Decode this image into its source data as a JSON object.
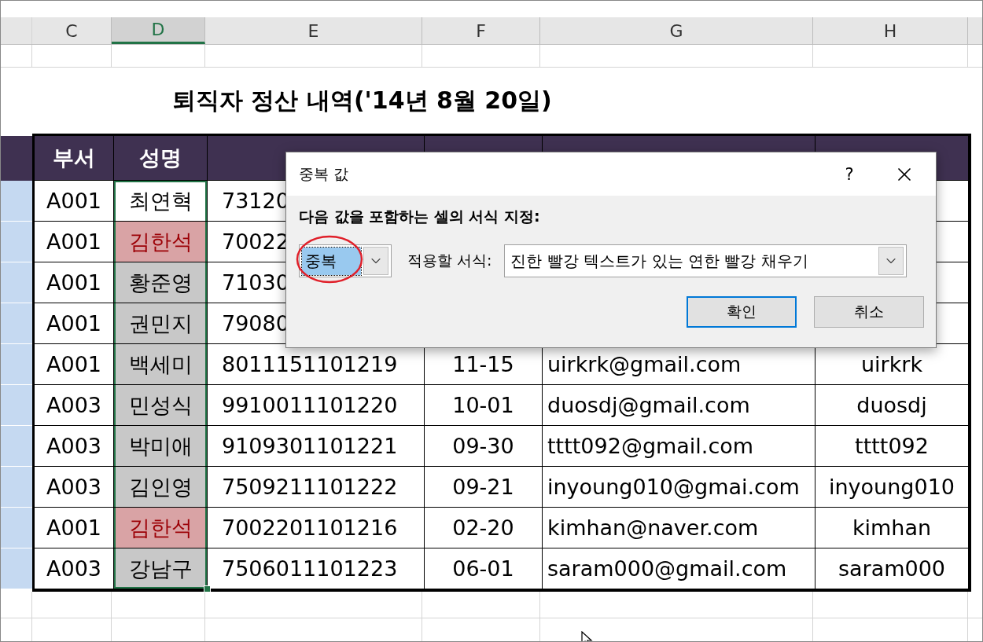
{
  "columns": [
    {
      "letter": "C",
      "selected": false
    },
    {
      "letter": "D",
      "selected": true
    },
    {
      "letter": "E",
      "selected": false
    },
    {
      "letter": "F",
      "selected": false
    },
    {
      "letter": "G",
      "selected": false
    },
    {
      "letter": "H",
      "selected": false
    }
  ],
  "title": "퇴직자 정산 내역('14년 8월 20일)",
  "table": {
    "headers": [
      "부서",
      "성명"
    ],
    "rows": [
      {
        "dept": "A001",
        "name": "최연혁",
        "duplicate": false,
        "active": true,
        "id": "73120"
      },
      {
        "dept": "A001",
        "name": "김한석",
        "duplicate": true,
        "active": false,
        "id": "70022"
      },
      {
        "dept": "A001",
        "name": "황준영",
        "duplicate": false,
        "active": false,
        "id": "71030"
      },
      {
        "dept": "A001",
        "name": "권민지",
        "duplicate": false,
        "active": false,
        "id": "79080"
      },
      {
        "dept": "A001",
        "name": "백세미",
        "duplicate": false,
        "active": false,
        "id": "8011151101219",
        "date": "11-15",
        "email": "uirkrk@gmail.com",
        "user": "uirkrk"
      },
      {
        "dept": "A003",
        "name": "민성식",
        "duplicate": false,
        "active": false,
        "id": "9910011101220",
        "date": "10-01",
        "email": "duosdj@gmail.com",
        "user": "duosdj"
      },
      {
        "dept": "A003",
        "name": "박미애",
        "duplicate": false,
        "active": false,
        "id": "9109301101221",
        "date": "09-30",
        "email": "tttt092@gmail.com",
        "user": "tttt092"
      },
      {
        "dept": "A003",
        "name": "김인영",
        "duplicate": false,
        "active": false,
        "id": "7509211101222",
        "date": "09-21",
        "email": "inyoung010@gmai.com",
        "user": "inyoung010"
      },
      {
        "dept": "A001",
        "name": "김한석",
        "duplicate": true,
        "active": false,
        "id": "7002201101216",
        "date": "02-20",
        "email": "kimhan@naver.com",
        "user": "kimhan"
      },
      {
        "dept": "A003",
        "name": "강남구",
        "duplicate": false,
        "active": false,
        "id": "7506011101223",
        "date": "06-01",
        "email": "saram000@gmail.com",
        "user": "saram000"
      }
    ]
  },
  "dialog": {
    "title": "중복 값",
    "help": "?",
    "prompt": "다음 값을 포함하는 셀의 서식 지정:",
    "rule": {
      "value": "중복",
      "selected": true,
      "circled": true
    },
    "format_label": "적용할 서식:",
    "format": {
      "value": "진한 빨강 텍스트가 있는 연한 빨강 채우기"
    },
    "buttons": [
      {
        "label": "확인",
        "default": true
      },
      {
        "label": "취소",
        "default": false
      }
    ]
  }
}
